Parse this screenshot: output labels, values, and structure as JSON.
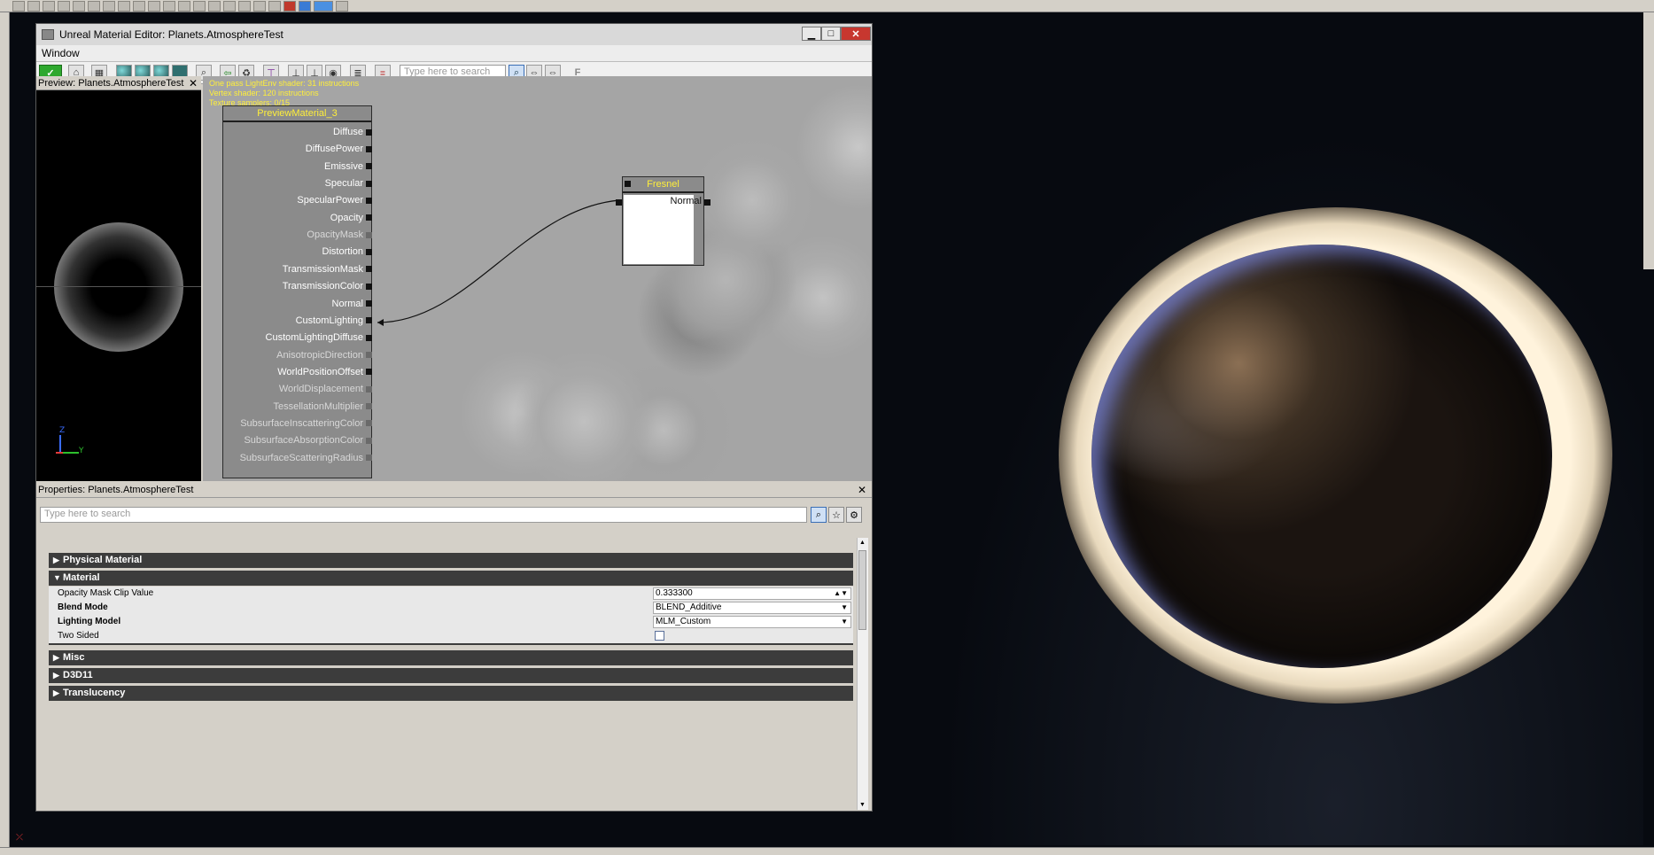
{
  "window": {
    "title": "Unreal Material Editor: Planets.AtmosphereTest",
    "minimize_glyph": "▁",
    "maximize_glyph": "□",
    "close_glyph": "✕"
  },
  "menu": {
    "window_label": "Window"
  },
  "toolbar": {
    "apply_glyph": "✓",
    "search_placeholder": "Type here to search",
    "search_glyph": "⌕",
    "find_glyph": "F"
  },
  "preview": {
    "title": "Preview: Planets.AtmosphereTest",
    "close_glyph": "✕",
    "axis_z": "Z",
    "axis_y": "Y"
  },
  "graph": {
    "stats": [
      "One pass LightEnv shader: 31 instructions",
      "Vertex shader: 120 instructions",
      "Texture samplers: 0/15"
    ],
    "main_node": {
      "title": "PreviewMaterial_3",
      "pins": [
        {
          "label": "Diffuse",
          "enabled": true
        },
        {
          "label": "DiffusePower",
          "enabled": true
        },
        {
          "label": "Emissive",
          "enabled": true
        },
        {
          "label": "Specular",
          "enabled": true
        },
        {
          "label": "SpecularPower",
          "enabled": true
        },
        {
          "label": "Opacity",
          "enabled": true
        },
        {
          "label": "OpacityMask",
          "enabled": false
        },
        {
          "label": "Distortion",
          "enabled": true
        },
        {
          "label": "TransmissionMask",
          "enabled": true
        },
        {
          "label": "TransmissionColor",
          "enabled": true
        },
        {
          "label": "Normal",
          "enabled": true
        },
        {
          "label": "CustomLighting",
          "enabled": true
        },
        {
          "label": "CustomLightingDiffuse",
          "enabled": true
        },
        {
          "label": "AnisotropicDirection",
          "enabled": false
        },
        {
          "label": "WorldPositionOffset",
          "enabled": true
        },
        {
          "label": "WorldDisplacement",
          "enabled": false
        },
        {
          "label": "TessellationMultiplier",
          "enabled": false
        },
        {
          "label": "SubsurfaceInscatteringColor",
          "enabled": false
        },
        {
          "label": "SubsurfaceAbsorptionColor",
          "enabled": false
        },
        {
          "label": "SubsurfaceScatteringRadius",
          "enabled": false
        }
      ]
    },
    "fresnel_node": {
      "title": "Fresnel",
      "input_label": "Normal"
    }
  },
  "properties": {
    "title": "Properties: Planets.AtmosphereTest",
    "close_glyph": "✕",
    "search_placeholder": "Type here to search",
    "categories": {
      "physical_material": "Physical Material",
      "material": "Material",
      "misc": "Misc",
      "d3d11": "D3D11",
      "translucency": "Translucency"
    },
    "rows": {
      "opacity_mask_clip": {
        "name": "Opacity Mask Clip Value",
        "value": "0.333300"
      },
      "blend_mode": {
        "name": "Blend Mode",
        "value": "BLEND_Additive"
      },
      "lighting_model": {
        "name": "Lighting Model",
        "value": "MLM_Custom"
      },
      "two_sided": {
        "name": "Two Sided",
        "checked": false
      }
    }
  },
  "colors": {
    "node_title": "#ffef3a",
    "apply": "#2ea82e",
    "close": "#c7372f"
  }
}
